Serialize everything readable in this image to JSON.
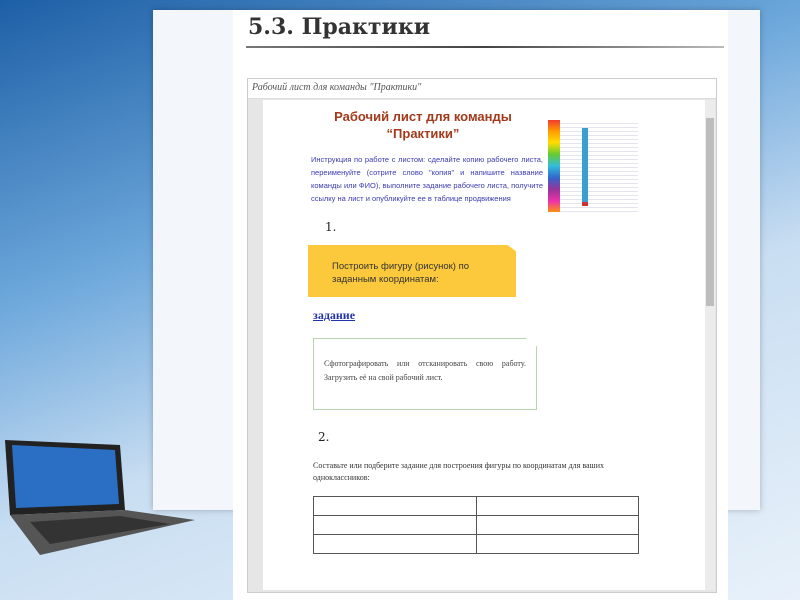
{
  "slide": {
    "title": "5.3. Практики"
  },
  "frame": {
    "header": "Рабочий лист для команды \"Практики\""
  },
  "doc": {
    "heading_line1": "Рабочий лист для команды",
    "heading_line2": "“Практики”",
    "instructions": "Инструкция по работе с листом: сделайте копию рабочего листа, переименуйте (сотрите слово \"копия\" и напишите название команды или ФИО), выполните задание рабочего листа, получите ссылку на лист и опубликуйте ее в таблице продвижения",
    "step1": "1.",
    "task1": "Построить фигуру (рисунок) по заданным координатам:",
    "task_link": "задание",
    "note": "Сфотографировать или отсканировать свою работу. Загрузить её на свой рабочий лист.",
    "step2": "2.",
    "task2": "Составьте или подберите задание для построения фигуры по координатам для ваших одноклассников:"
  }
}
